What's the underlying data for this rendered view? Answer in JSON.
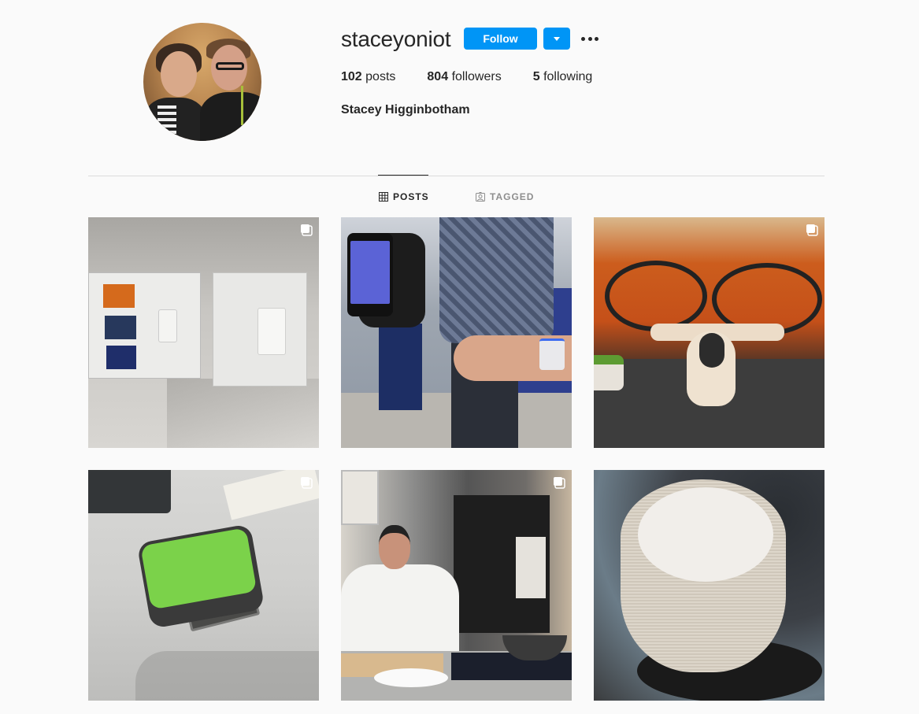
{
  "profile": {
    "username": "staceyoniot",
    "full_name": "Stacey Higginbotham",
    "avatar_icon": "profile-photo",
    "follow_label": "Follow",
    "dropdown_icon": "triangle-down-icon",
    "more_icon": "ellipsis-icon",
    "accent_color": "#0095f6",
    "stats": {
      "posts_count": "102",
      "posts_label": "posts",
      "followers_count": "804",
      "followers_label": "followers",
      "following_count": "5",
      "following_label": "following"
    }
  },
  "tabs": [
    {
      "label": "POSTS",
      "icon": "grid-icon",
      "active": true
    },
    {
      "label": "TAGGED",
      "icon": "tagged-user-icon",
      "active": false
    }
  ],
  "posts": [
    {
      "subject": "smart light switches display",
      "multi_image": true
    },
    {
      "subject": "phone app and wrist wearable at trade show",
      "multi_image": false
    },
    {
      "subject": "white drone on display table",
      "multi_image": true
    },
    {
      "subject": "green tracker device",
      "multi_image": true
    },
    {
      "subject": "chef cooking demo with smart fridge",
      "multi_image": true
    },
    {
      "subject": "smart speaker with wireless charging top",
      "multi_image": false
    }
  ]
}
